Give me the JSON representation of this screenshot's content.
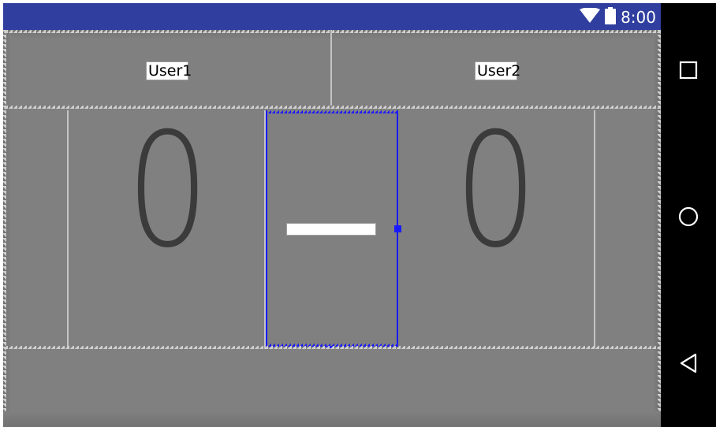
{
  "status_bar": {
    "time": "8:00",
    "icons": [
      "wifi-icon",
      "battery-icon"
    ],
    "color": "#303f9f"
  },
  "navigation_bar": {
    "buttons": [
      "recents-square-icon",
      "home-circle-icon",
      "back-triangle-icon"
    ],
    "color": "#000000"
  },
  "scoreboard": {
    "player1_name": "User1",
    "player2_name": "User2",
    "player1_score": "0",
    "player2_score": "0",
    "separator": "dash"
  },
  "editor": {
    "selection_color": "#1a1aff",
    "canvas_color": "#808080"
  }
}
